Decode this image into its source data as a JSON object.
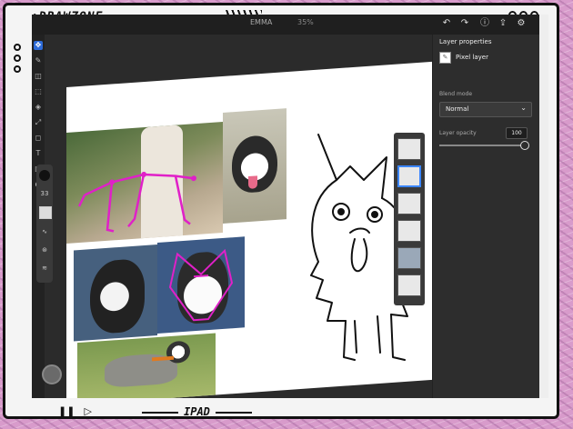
{
  "frame": {
    "title": ":DRAWZONE",
    "bottom_label": "IPAD",
    "bottom_icons": [
      "❚❚",
      "▷"
    ]
  },
  "topbar": {
    "doc_title": "EMMA",
    "doc_zoom": "35%",
    "icons": [
      "undo-icon",
      "redo-icon",
      "info-icon",
      "share-icon",
      "cloud-icon",
      "settings-icon"
    ]
  },
  "tools": {
    "icons": [
      "move-icon",
      "brush-icon",
      "eraser-icon",
      "selection-icon",
      "fill-icon",
      "transform-icon",
      "text-icon",
      "shape-icon",
      "image-icon",
      "color-icon"
    ],
    "brush_size": "33"
  },
  "layer_properties": {
    "title": "Layer properties",
    "layer_type": "Pixel layer",
    "blend_mode_label": "Blend mode",
    "blend_mode_value": "Normal",
    "opacity_label": "Layer opacity",
    "opacity_value": "100",
    "opacity_fraction": 1.0
  },
  "layers": {
    "count": 6,
    "selected_index": 1
  },
  "colors": {
    "accent": "#3b86ff",
    "panel": "#2d2d2d",
    "pose_lines": "#e020c8"
  }
}
